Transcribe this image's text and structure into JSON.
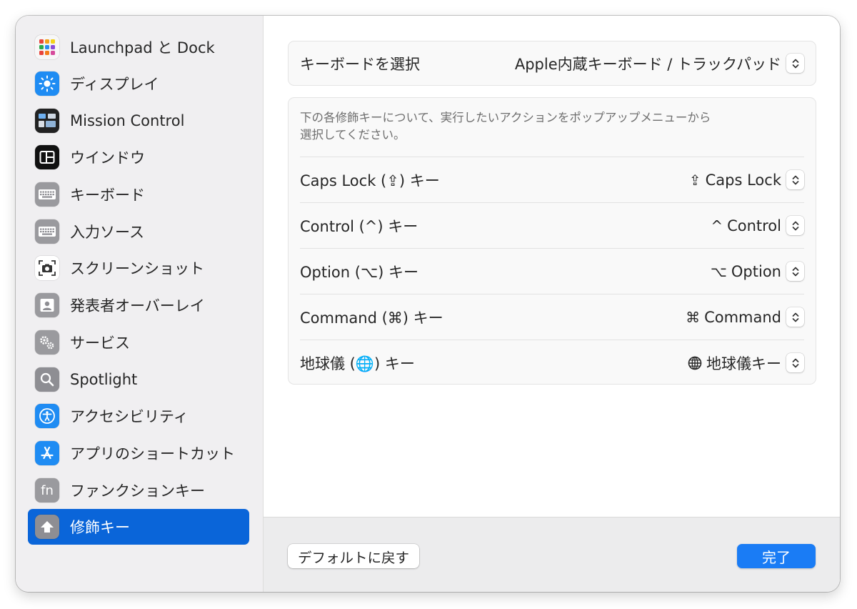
{
  "sidebar": {
    "items": [
      {
        "label": "Launchpad と Dock",
        "icon": "launchpad-dock-icon"
      },
      {
        "label": "ディスプレイ",
        "icon": "display-icon"
      },
      {
        "label": "Mission Control",
        "icon": "mission-control-icon"
      },
      {
        "label": "ウインドウ",
        "icon": "window-icon"
      },
      {
        "label": "キーボード",
        "icon": "keyboard-icon"
      },
      {
        "label": "入力ソース",
        "icon": "input-sources-icon"
      },
      {
        "label": "スクリーンショット",
        "icon": "screenshot-icon"
      },
      {
        "label": "発表者オーバーレイ",
        "icon": "presenter-overlay-icon"
      },
      {
        "label": "サービス",
        "icon": "services-icon"
      },
      {
        "label": "Spotlight",
        "icon": "spotlight-icon"
      },
      {
        "label": "アクセシビリティ",
        "icon": "accessibility-icon"
      },
      {
        "label": "アプリのショートカット",
        "icon": "app-shortcuts-icon"
      },
      {
        "label": "ファンクションキー",
        "icon": "function-keys-icon"
      },
      {
        "label": "修飾キー",
        "icon": "modifier-keys-icon"
      }
    ],
    "selected_label": "修飾キー"
  },
  "keyboard_select": {
    "label": "キーボードを選択",
    "value": "Apple内蔵キーボード / トラックパッド"
  },
  "modifiers": {
    "description_line1": "下の各修飾キーについて、実行したいアクションをポップアップメニューから",
    "description_line2": "選択してください。",
    "rows": [
      {
        "label": "Caps Lock (⇪) キー",
        "value_symbol": "⇪",
        "value": "Caps Lock"
      },
      {
        "label": "Control (^) キー",
        "value_symbol": "^",
        "value": "Control"
      },
      {
        "label": "Option (⌥) キー",
        "value_symbol": "⌥",
        "value": "Option"
      },
      {
        "label": "Command (⌘) キー",
        "value_symbol": "⌘",
        "value": "Command"
      },
      {
        "label": "地球儀 (🌐) キー",
        "value_symbol": "globe-icon",
        "value": "地球儀キー"
      }
    ]
  },
  "footer": {
    "restore_defaults": "デフォルトに戻す",
    "done": "完了"
  },
  "colors": {
    "accent": "#0a65d9",
    "done_button": "#1a7cf5",
    "sidebar_bg": "#f0eff1"
  }
}
